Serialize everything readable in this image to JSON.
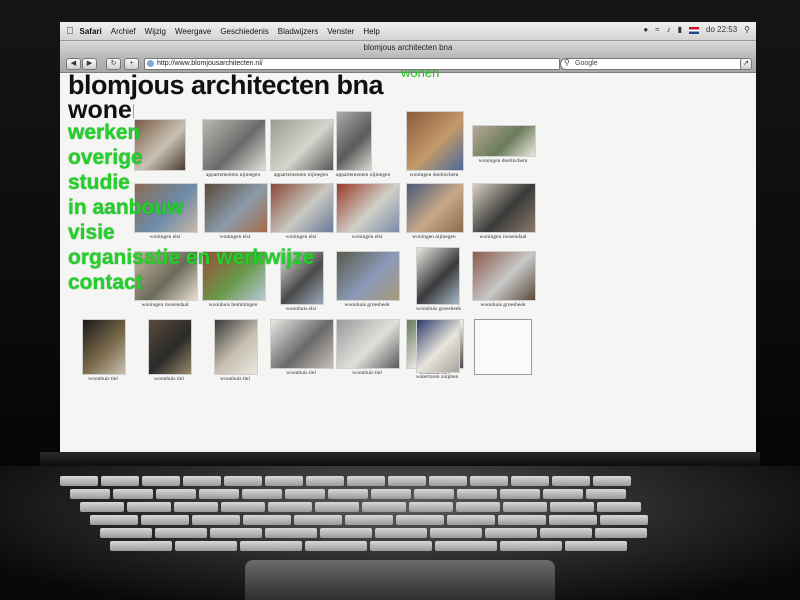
{
  "menubar": {
    "items": [
      "Safari",
      "Archief",
      "Wijzig",
      "Weergave",
      "Geschiedenis",
      "Bladwijzers",
      "Venster",
      "Help"
    ],
    "clock": "do 22:53"
  },
  "browser": {
    "window_title": "blomjous architecten bna",
    "url": "http://www.blomjousarchitecten.nl/",
    "search_placeholder": "Google"
  },
  "site": {
    "title": "blomjous architecten bna",
    "current_section_small": "wonen",
    "current_section_large": "wonen",
    "nav": [
      "werken",
      "overige",
      "studie",
      "in aanbouw",
      "visie",
      "organisatie en werkwijze",
      "contact"
    ]
  },
  "gallery": [
    {
      "caption": "",
      "colors": [
        "#7a5a45",
        "#c9c2b5",
        "#4b3b30"
      ]
    },
    {
      "caption": "appartementen nijmegen",
      "colors": [
        "#b8b8b0",
        "#6b6b6b",
        "#e0e0da"
      ]
    },
    {
      "caption": "appartementen nijmegen",
      "colors": [
        "#9a9a92",
        "#d5d5cd",
        "#565656"
      ]
    },
    {
      "caption": "appartementen nijmegen",
      "colors": [
        "#a8acaa",
        "#5a5a5a",
        "#d8d8d2"
      ]
    },
    {
      "caption": "woningen doetinchem",
      "colors": [
        "#8a5a3a",
        "#c49a6a",
        "#4a6a9a"
      ]
    },
    {
      "caption": "woningen doetinchem",
      "colors": [
        "#b8a898",
        "#6a7a5a",
        "#ece8e0"
      ]
    },
    {
      "caption": "woningen elst",
      "colors": [
        "#8b6b55",
        "#6b8ba8",
        "#c9b8a5"
      ]
    },
    {
      "caption": "woningen elst",
      "colors": [
        "#5a4a3a",
        "#8a9aa8",
        "#a86a4a"
      ]
    },
    {
      "caption": "woningen elst",
      "colors": [
        "#8a4a3a",
        "#c8c8c0",
        "#6a7a9a"
      ]
    },
    {
      "caption": "woningen elst",
      "colors": [
        "#9a3a2a",
        "#d0d0c8",
        "#7a8aa8"
      ]
    },
    {
      "caption": "woningen nijmegen",
      "colors": [
        "#4a5a7a",
        "#c8a888",
        "#8a6a4a"
      ]
    },
    {
      "caption": "woningen roosendaal",
      "colors": [
        "#d8d0c0",
        "#3a3a3a",
        "#8a7a6a"
      ]
    },
    {
      "caption": "woningen roosendaal",
      "colors": [
        "#c8b8a0",
        "#6a6a5a",
        "#e8e0d0"
      ]
    },
    {
      "caption": "woonhuis bemmingen",
      "colors": [
        "#9a4a3a",
        "#6a9a4a",
        "#b8c8d8"
      ]
    },
    {
      "caption": "woonhuis elst",
      "colors": [
        "#e0e0dc",
        "#4a4a4a",
        "#9aa8b8"
      ]
    },
    {
      "caption": "woonhuis groesbeek",
      "colors": [
        "#5a5a4a",
        "#8a9ab8",
        "#a89a7a"
      ]
    },
    {
      "caption": "woonhuis groesbeek",
      "colors": [
        "#e8e8e4",
        "#3a3a3a",
        "#a8b8c8"
      ]
    },
    {
      "caption": "woonhuis groesbeek",
      "colors": [
        "#8a5a4a",
        "#c8c8c8",
        "#5a4a3a"
      ]
    },
    {
      "caption": "woonhuis tiel",
      "colors": [
        "#1a1a1a",
        "#7a6a4a",
        "#c8c0b0"
      ]
    },
    {
      "caption": "woonhuis tiel",
      "colors": [
        "#5a4a3a",
        "#2a2a2a",
        "#9a8a6a"
      ]
    },
    {
      "caption": "woonhuis tiel",
      "colors": [
        "#3a3a3a",
        "#c8c0b0",
        "#e8e8e0"
      ]
    },
    {
      "caption": "woonhuis tiel",
      "colors": [
        "#e8e8e4",
        "#6a6a6a",
        "#c8c0b8"
      ]
    },
    {
      "caption": "woonhuis tiel",
      "colors": [
        "#9a9a9a",
        "#e0e0dc",
        "#5a5a5a"
      ]
    },
    {
      "caption": "woonhuis tiel",
      "colors": [
        "#6a7a5a",
        "#e8e8e4",
        "#4a4a4a"
      ]
    },
    {
      "caption": "watertoren zutphen",
      "colors": [
        "#2a3a6a",
        "#e8e4dc",
        "#a8a49c"
      ]
    },
    {
      "caption": "",
      "colors": [
        "#fafafa",
        "#fafafa",
        "#fafafa"
      ]
    }
  ]
}
